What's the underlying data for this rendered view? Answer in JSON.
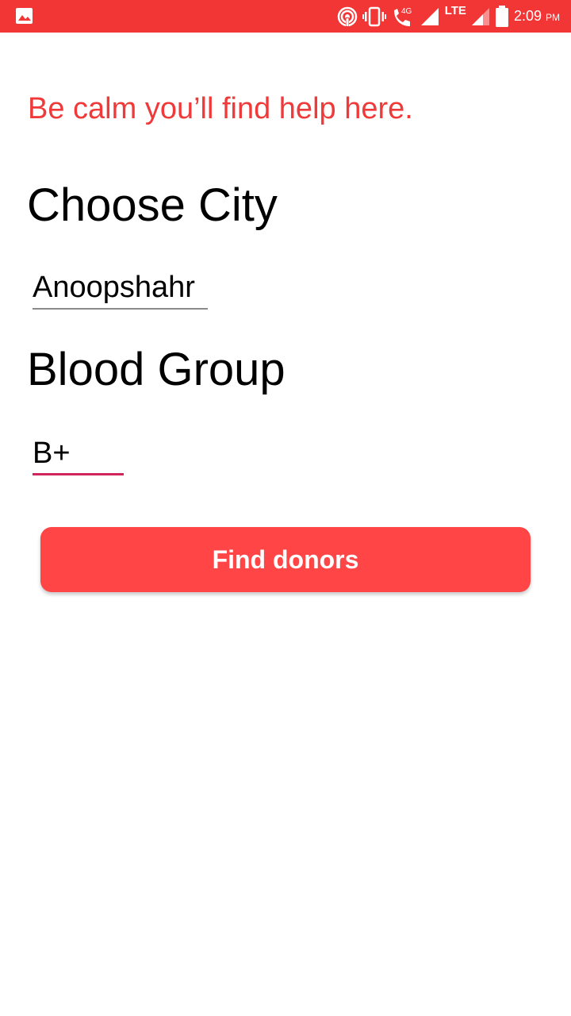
{
  "status_bar": {
    "network_label": "4G",
    "lte_label": "LTE",
    "time": "2:09",
    "time_suffix": "PM",
    "icons": [
      "image-icon",
      "hotspot-icon",
      "vibrate-icon",
      "wifi-call-icon",
      "signal-icon",
      "signal-icon",
      "battery-icon"
    ],
    "color": "#f23535"
  },
  "main": {
    "tagline": "Be calm you’ll find help here.",
    "city_heading": "Choose City",
    "city_value": "Anoopshahr",
    "blood_heading": "Blood Group",
    "blood_value": "B+",
    "find_button": "Find donors",
    "accent": "#ff4545",
    "tagline_color": "#f03a3a",
    "spinner_active_color": "#d0245a"
  }
}
